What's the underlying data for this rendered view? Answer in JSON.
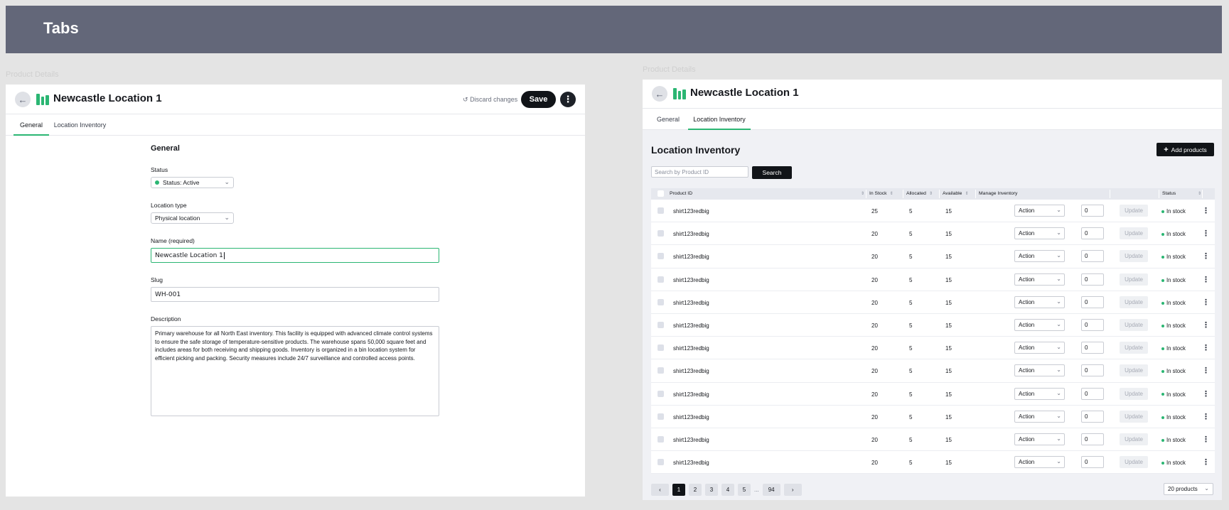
{
  "banner": {
    "title": "Tabs"
  },
  "ghost_labels": {
    "left": "Product Details",
    "right": "Product Details"
  },
  "left_panel": {
    "title": "Newcastle Location 1",
    "discard_label": "Discard changes",
    "save_label": "Save",
    "tabs": [
      {
        "label": "General",
        "active": true
      },
      {
        "label": "Location Inventory",
        "active": false
      }
    ],
    "form": {
      "section_title": "General",
      "status_label": "Status",
      "status_value": "Status: Active",
      "location_type_label": "Location type",
      "location_type_value": "Physical location",
      "name_label": "Name (required)",
      "name_value": "Newcastle Location 1",
      "slug_label": "Slug",
      "slug_value": "WH-001",
      "description_label": "Description",
      "description_value": "Primary warehouse for all North East inventory. This facility is equipped with advanced climate control systems to ensure the safe storage of temperature-sensitive products. The warehouse spans 50,000 square feet and includes areas for both receiving and shipping goods. Inventory is organized in a bin location system for efficient picking and packing. Security measures include 24/7 surveillance and controlled access points."
    }
  },
  "right_panel": {
    "title": "Newcastle Location 1",
    "tabs": [
      {
        "label": "General",
        "active": false
      },
      {
        "label": "Location Inventory",
        "active": true
      }
    ],
    "section_title": "Location Inventory",
    "add_button": "Add products",
    "search_placeholder": "Search by Product ID",
    "search_button": "Search",
    "columns": {
      "product_id": "Product ID",
      "in_stock": "In Stock",
      "allocated": "Allocated",
      "available": "Available",
      "manage": "Manage Inventory",
      "status": "Status"
    },
    "action_label": "Action",
    "update_label": "Update",
    "rows": [
      {
        "product_id": "shirt123redbig",
        "in_stock": "25",
        "allocated": "5",
        "available": "15",
        "qty": "0",
        "status": "In stock"
      },
      {
        "product_id": "shirt123redbig",
        "in_stock": "20",
        "allocated": "5",
        "available": "15",
        "qty": "0",
        "status": "In stock"
      },
      {
        "product_id": "shirt123redbig",
        "in_stock": "20",
        "allocated": "5",
        "available": "15",
        "qty": "0",
        "status": "In stock"
      },
      {
        "product_id": "shirt123redbig",
        "in_stock": "20",
        "allocated": "5",
        "available": "15",
        "qty": "0",
        "status": "In stock"
      },
      {
        "product_id": "shirt123redbig",
        "in_stock": "20",
        "allocated": "5",
        "available": "15",
        "qty": "0",
        "status": "In stock"
      },
      {
        "product_id": "shirt123redbig",
        "in_stock": "20",
        "allocated": "5",
        "available": "15",
        "qty": "0",
        "status": "In stock"
      },
      {
        "product_id": "shirt123redbig",
        "in_stock": "20",
        "allocated": "5",
        "available": "15",
        "qty": "0",
        "status": "In stock"
      },
      {
        "product_id": "shirt123redbig",
        "in_stock": "20",
        "allocated": "5",
        "available": "15",
        "qty": "0",
        "status": "In stock"
      },
      {
        "product_id": "shirt123redbig",
        "in_stock": "20",
        "allocated": "5",
        "available": "15",
        "qty": "0",
        "status": "In stock"
      },
      {
        "product_id": "shirt123redbig",
        "in_stock": "20",
        "allocated": "5",
        "available": "15",
        "qty": "0",
        "status": "In stock"
      },
      {
        "product_id": "shirt123redbig",
        "in_stock": "20",
        "allocated": "5",
        "available": "15",
        "qty": "0",
        "status": "In stock"
      },
      {
        "product_id": "shirt123redbig",
        "in_stock": "20",
        "allocated": "5",
        "available": "15",
        "qty": "0",
        "status": "In stock"
      }
    ],
    "pagination": {
      "pages": [
        "1",
        "2",
        "3",
        "4",
        "5"
      ],
      "ellipsis": "...",
      "last": "94",
      "active": "1"
    },
    "per_page": "20 products"
  },
  "colors": {
    "accent": "#2bb673",
    "banner": "#636779",
    "dark": "#111418"
  },
  "icons": [
    "arrow-left-icon",
    "building-icon",
    "undo-icon",
    "kebab-icon",
    "chevron-down-icon",
    "plus-icon",
    "search-icon",
    "chevron-left-icon",
    "chevron-right-icon"
  ]
}
